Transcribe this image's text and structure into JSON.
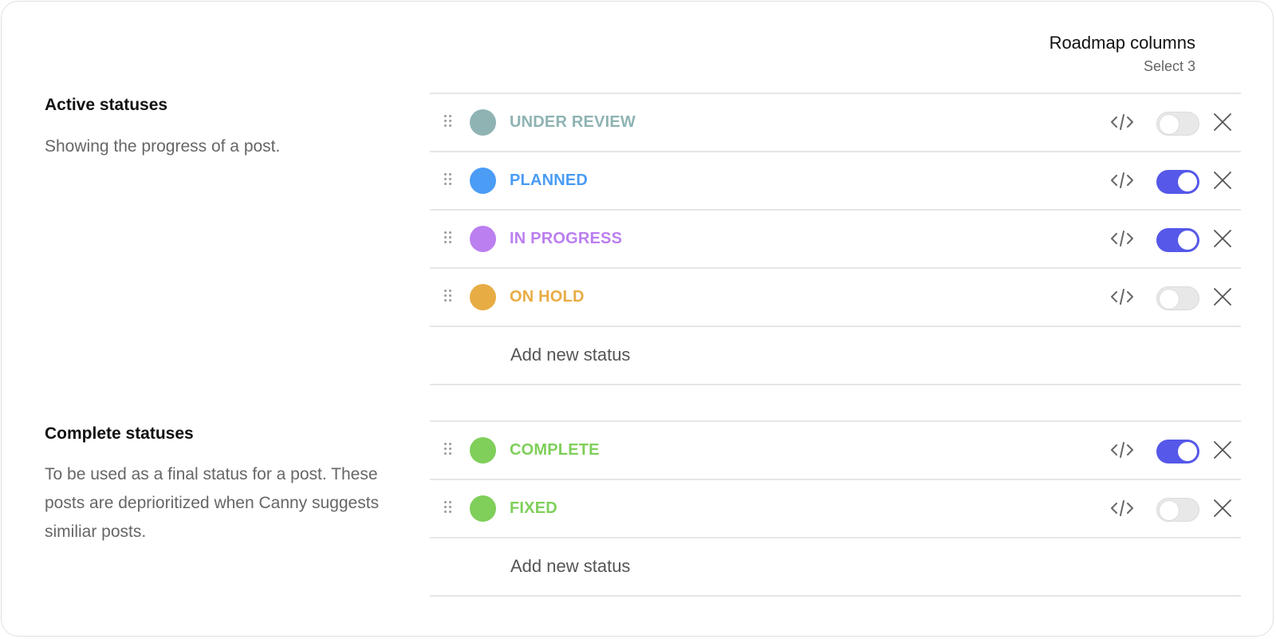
{
  "roadmap": {
    "title": "Roadmap columns",
    "subtitle": "Select 3"
  },
  "active": {
    "title": "Active statuses",
    "description": "Showing the progress of a post.",
    "add_label": "Add new status",
    "items": [
      {
        "label": "UNDER REVIEW",
        "color": "#8fb3b3",
        "roadmap_enabled": false
      },
      {
        "label": "PLANNED",
        "color": "#4a9cf5",
        "roadmap_enabled": true
      },
      {
        "label": "IN PROGRESS",
        "color": "#bb7ff0",
        "roadmap_enabled": true
      },
      {
        "label": "ON HOLD",
        "color": "#e8ac44",
        "roadmap_enabled": false
      }
    ]
  },
  "complete": {
    "title": "Complete statuses",
    "description": "To be used as a final status for a post. These posts are deprioritized when Canny suggests similiar posts.",
    "add_label": "Add new status",
    "items": [
      {
        "label": "COMPLETE",
        "color": "#7fcf5a",
        "roadmap_enabled": true
      },
      {
        "label": "FIXED",
        "color": "#7fcf5a",
        "roadmap_enabled": false
      }
    ]
  },
  "colors": {
    "toggle_on": "#5558e8",
    "toggle_off": "#e8e8e8",
    "divider": "#e6e6e6"
  },
  "icons": {
    "drag": "drag-handle-icon",
    "code": "code-icon",
    "close": "close-icon"
  }
}
